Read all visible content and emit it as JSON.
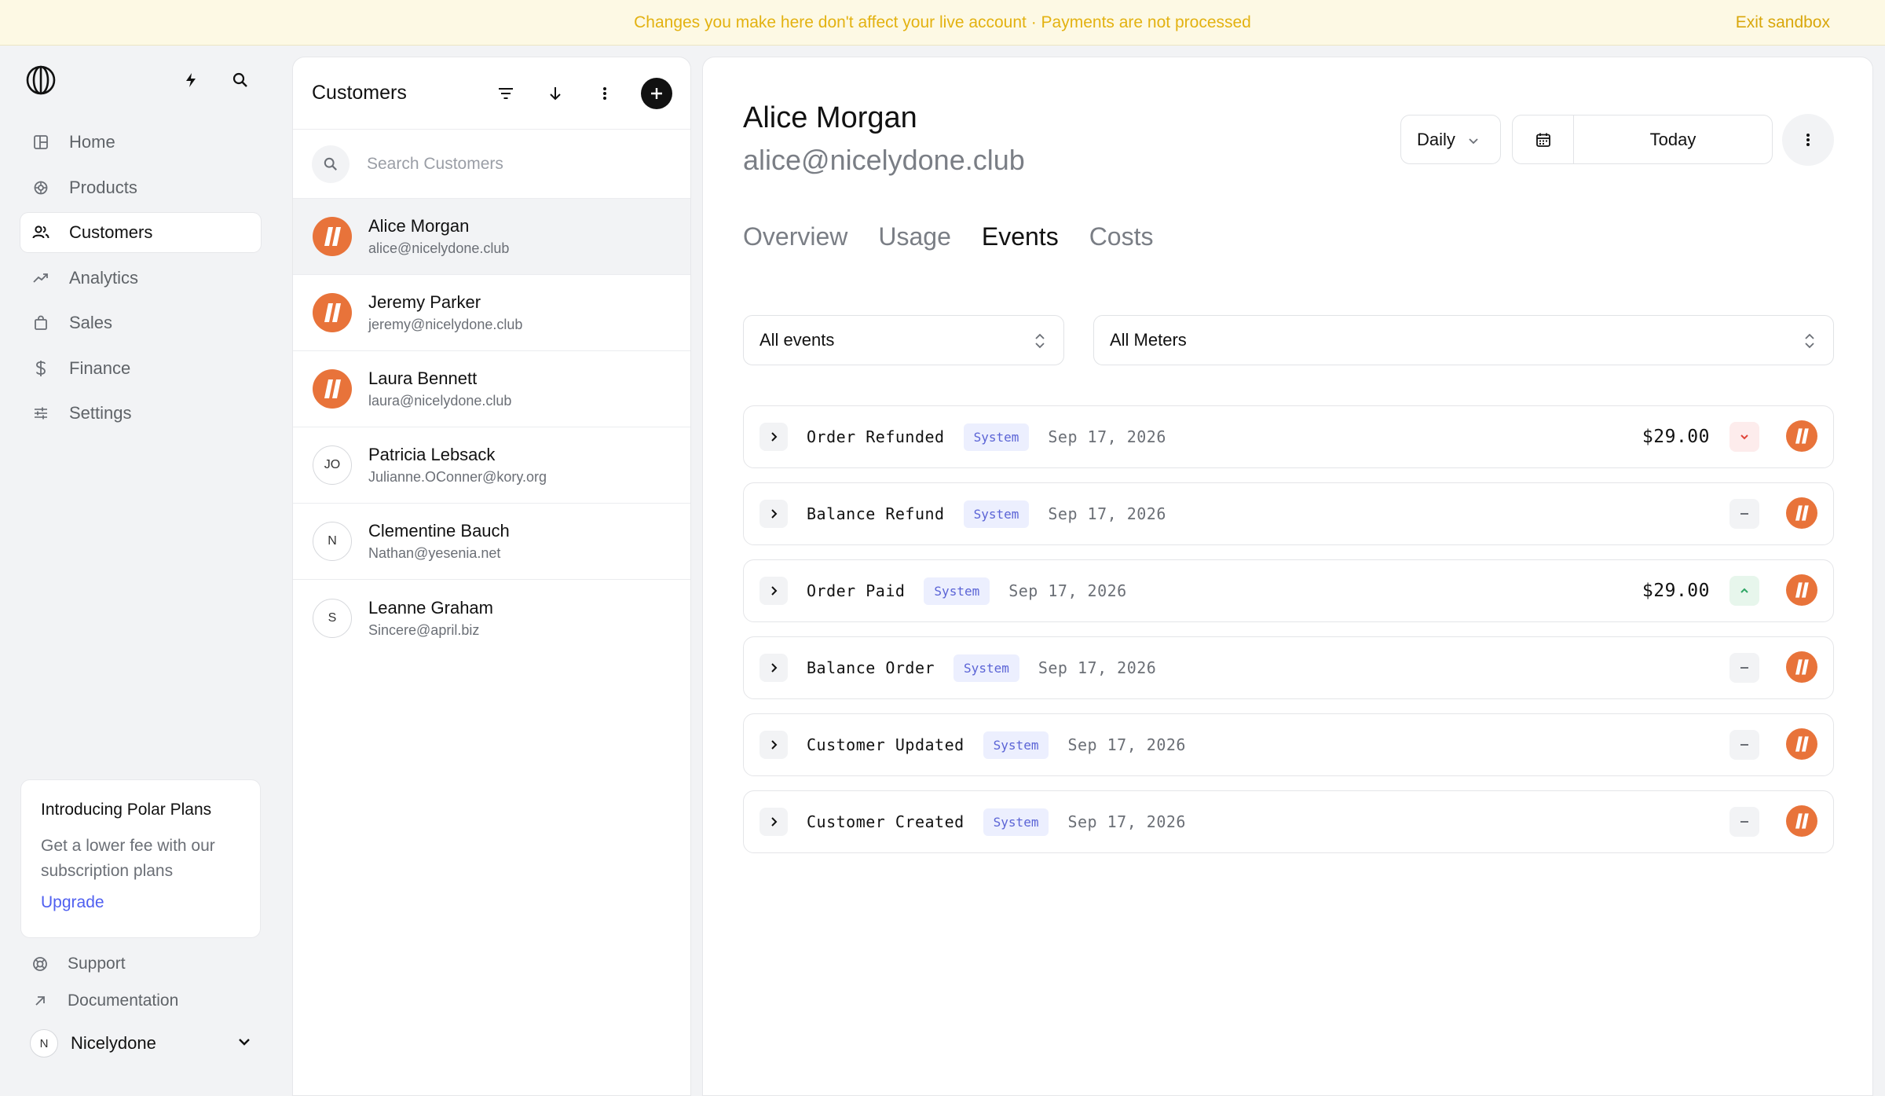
{
  "banner": {
    "message": "Changes you make here don't affect your live account · Payments are not processed",
    "exit_label": "Exit sandbox"
  },
  "sidebar": {
    "items": [
      {
        "label": "Home",
        "icon": "home-icon"
      },
      {
        "label": "Products",
        "icon": "products-icon"
      },
      {
        "label": "Customers",
        "icon": "customers-icon",
        "active": true
      },
      {
        "label": "Analytics",
        "icon": "analytics-icon"
      },
      {
        "label": "Sales",
        "icon": "sales-icon"
      },
      {
        "label": "Finance",
        "icon": "finance-icon"
      },
      {
        "label": "Settings",
        "icon": "settings-icon"
      }
    ],
    "promo": {
      "title": "Introducing Polar Plans",
      "description": "Get a lower fee with our subscription plans",
      "cta": "Upgrade"
    },
    "support_label": "Support",
    "docs_label": "Documentation",
    "org": {
      "initial": "N",
      "name": "Nicelydone"
    }
  },
  "customers_panel": {
    "title": "Customers",
    "search_placeholder": "Search Customers",
    "customers": [
      {
        "name": "Alice Morgan",
        "email": "alice@nicelydone.club",
        "avatar": "logo",
        "active": true
      },
      {
        "name": "Jeremy Parker",
        "email": "jeremy@nicelydone.club",
        "avatar": "logo"
      },
      {
        "name": "Laura Bennett",
        "email": "laura@nicelydone.club",
        "avatar": "logo"
      },
      {
        "name": "Patricia Lebsack",
        "email": "Julianne.OConner@kory.org",
        "initials": "JO"
      },
      {
        "name": "Clementine Bauch",
        "email": "Nathan@yesenia.net",
        "initials": "N"
      },
      {
        "name": "Leanne Graham",
        "email": "Sincere@april.biz",
        "initials": "S"
      }
    ]
  },
  "detail": {
    "name": "Alice Morgan",
    "email": "alice@nicelydone.club",
    "interval": "Daily",
    "date_label": "Today",
    "tabs": [
      "Overview",
      "Usage",
      "Events",
      "Costs"
    ],
    "active_tab": "Events",
    "filters": {
      "events": "All events",
      "meters": "All Meters"
    },
    "events": [
      {
        "name": "Order Refunded",
        "badge": "System",
        "date": "Sep 17, 2026",
        "amount": "$29.00",
        "indicator": "down"
      },
      {
        "name": "Balance Refund",
        "badge": "System",
        "date": "Sep 17, 2026",
        "amount": "",
        "indicator": "none"
      },
      {
        "name": "Order Paid",
        "badge": "System",
        "date": "Sep 17, 2026",
        "amount": "$29.00",
        "indicator": "up"
      },
      {
        "name": "Balance Order",
        "badge": "System",
        "date": "Sep 17, 2026",
        "amount": "",
        "indicator": "none"
      },
      {
        "name": "Customer Updated",
        "badge": "System",
        "date": "Sep 17, 2026",
        "amount": "",
        "indicator": "none"
      },
      {
        "name": "Customer Created",
        "badge": "System",
        "date": "Sep 17, 2026",
        "amount": "",
        "indicator": "none"
      }
    ]
  },
  "colors": {
    "brand_orange": "#e8733a",
    "banner_text": "#e3b211",
    "link": "#4f5ff0",
    "badge_bg": "#eceffe",
    "badge_text": "#5b64d6"
  }
}
